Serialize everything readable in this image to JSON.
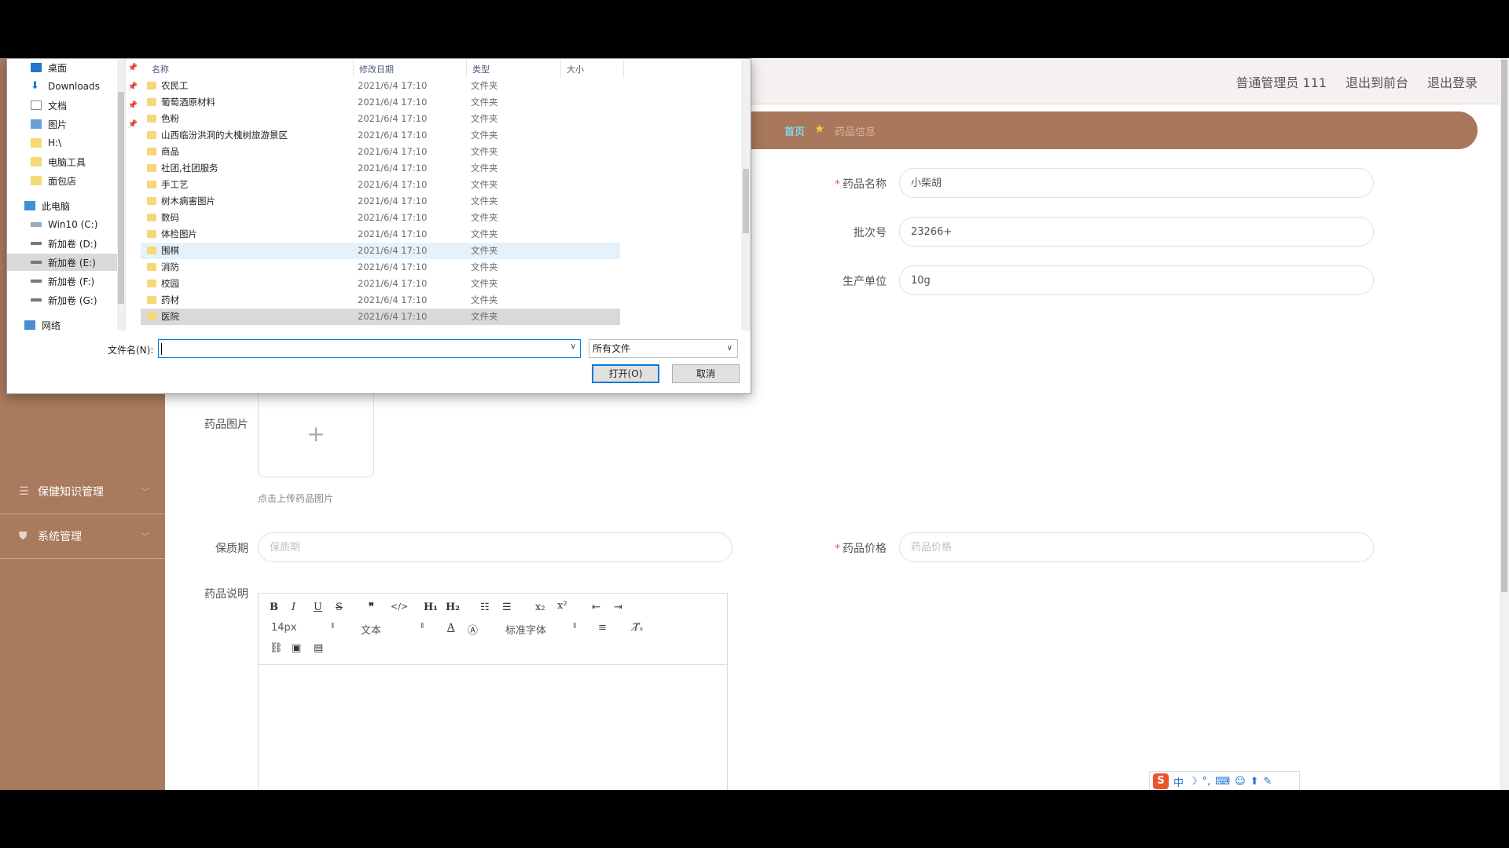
{
  "header": {
    "user": "普通管理员 111",
    "to_front": "退出到前台",
    "logout": "退出登录"
  },
  "breadcrumb": {
    "home": "首页",
    "current": "药品信息"
  },
  "sidebar": {
    "items": [
      {
        "label": "保健知识管理",
        "icon": "list-icon"
      },
      {
        "label": "系统管理",
        "icon": "shield-icon"
      }
    ]
  },
  "form": {
    "name": {
      "label": "药品名称",
      "value": "小柴胡"
    },
    "batch": {
      "label": "批次号",
      "value": "23266+"
    },
    "maker": {
      "label": "生产单位",
      "value": "10g"
    },
    "image": {
      "label": "药品图片",
      "hint": "点击上传药品图片"
    },
    "shelf": {
      "label": "保质期",
      "placeholder": "保质期"
    },
    "price": {
      "label": "药品价格",
      "placeholder": "药品价格"
    },
    "desc": {
      "label": "药品说明"
    }
  },
  "editor": {
    "font_size": "14px",
    "text_type": "文本",
    "font_family": "标准字体"
  },
  "dialog": {
    "nav": [
      {
        "label": "桌面",
        "icon": "desktop-icon",
        "pinned": true
      },
      {
        "label": "Downloads",
        "icon": "download-icon",
        "pinned": true
      },
      {
        "label": "文档",
        "icon": "document-icon",
        "pinned": true
      },
      {
        "label": "图片",
        "icon": "picture-icon",
        "pinned": true
      },
      {
        "label": "H:\\",
        "icon": "folder-icon"
      },
      {
        "label": "电脑工具",
        "icon": "folder-icon"
      },
      {
        "label": "面包店",
        "icon": "folder-icon"
      },
      {
        "label": "此电脑",
        "icon": "computer-icon"
      },
      {
        "label": "Win10 (C:)",
        "icon": "drive-icon"
      },
      {
        "label": "新加卷 (D:)",
        "icon": "drive-icon"
      },
      {
        "label": "新加卷 (E:)",
        "icon": "drive-icon",
        "selected": true
      },
      {
        "label": "新加卷 (F:)",
        "icon": "drive-icon"
      },
      {
        "label": "新加卷 (G:)",
        "icon": "drive-icon"
      },
      {
        "label": "网络",
        "icon": "network-icon"
      }
    ],
    "columns": {
      "name": "名称",
      "date": "修改日期",
      "type": "类型",
      "size": "大小"
    },
    "files": [
      {
        "name": "农民工",
        "date": "2021/6/4 17:10",
        "type": "文件夹"
      },
      {
        "name": "葡萄酒原材料",
        "date": "2021/6/4 17:10",
        "type": "文件夹"
      },
      {
        "name": "色粉",
        "date": "2021/6/4 17:10",
        "type": "文件夹"
      },
      {
        "name": "山西临汾洪洞的大槐树旅游景区",
        "date": "2021/6/4 17:10",
        "type": "文件夹"
      },
      {
        "name": "商品",
        "date": "2021/6/4 17:10",
        "type": "文件夹"
      },
      {
        "name": "社团,社团服务",
        "date": "2021/6/4 17:10",
        "type": "文件夹"
      },
      {
        "name": "手工艺",
        "date": "2021/6/4 17:10",
        "type": "文件夹"
      },
      {
        "name": "树木病害图片",
        "date": "2021/6/4 17:10",
        "type": "文件夹"
      },
      {
        "name": "数码",
        "date": "2021/6/4 17:10",
        "type": "文件夹"
      },
      {
        "name": "体检图片",
        "date": "2021/6/4 17:10",
        "type": "文件夹"
      },
      {
        "name": "围棋",
        "date": "2021/6/4 17:10",
        "type": "文件夹",
        "hover": true
      },
      {
        "name": "消防",
        "date": "2021/6/4 17:10",
        "type": "文件夹"
      },
      {
        "name": "校园",
        "date": "2021/6/4 17:10",
        "type": "文件夹"
      },
      {
        "name": "药材",
        "date": "2021/6/4 17:10",
        "type": "文件夹"
      },
      {
        "name": "医院",
        "date": "2021/6/4 17:10",
        "type": "文件夹",
        "selected": true
      }
    ],
    "filename_label": "文件名(N):",
    "filename_value": "",
    "filetype": "所有文件",
    "open_button": "打开(O)",
    "cancel_button": "取消"
  },
  "ime": {
    "label": "中"
  },
  "colors": {
    "sidebar": "#a97a5e",
    "breadcrumb": "#a9775b",
    "accent_link": "#7fd6e6",
    "focus_blue": "#0078d7"
  }
}
